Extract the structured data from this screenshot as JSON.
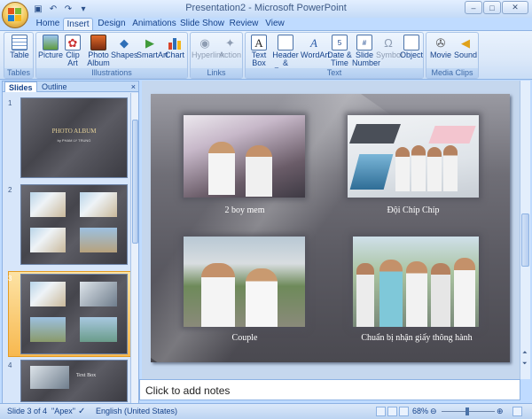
{
  "window": {
    "title": "Presentation2 - Microsoft PowerPoint",
    "buttons": [
      "–",
      "□",
      "✕"
    ]
  },
  "qat": {
    "icons": [
      "save-icon",
      "undo-icon",
      "redo-icon"
    ]
  },
  "tabs": [
    "Home",
    "Insert",
    "Design",
    "Animations",
    "Slide Show",
    "Review",
    "View"
  ],
  "active_tab": "Insert",
  "ribbon": {
    "groups": [
      {
        "label": "Tables",
        "buttons": [
          {
            "label": "Table"
          }
        ]
      },
      {
        "label": "Illustrations",
        "buttons": [
          {
            "label": "Picture"
          },
          {
            "label": "Clip Art"
          },
          {
            "label": "Photo Album"
          },
          {
            "label": "Shapes"
          },
          {
            "label": "SmartArt"
          },
          {
            "label": "Chart"
          }
        ]
      },
      {
        "label": "Links",
        "buttons": [
          {
            "label": "Hyperlink"
          },
          {
            "label": "Action"
          }
        ]
      },
      {
        "label": "Text",
        "buttons": [
          {
            "label": "Text Box"
          },
          {
            "label": "Header & Footer"
          },
          {
            "label": "WordArt"
          },
          {
            "label": "Date & Time"
          },
          {
            "label": "Slide Number"
          },
          {
            "label": "Symbol"
          },
          {
            "label": "Object"
          }
        ]
      },
      {
        "label": "Media Clips",
        "buttons": [
          {
            "label": "Movie"
          },
          {
            "label": "Sound"
          }
        ]
      }
    ]
  },
  "left_pane": {
    "tabs": [
      "Slides",
      "Outline"
    ],
    "close": "×",
    "slides": [
      {
        "num": "1",
        "title": "PHOTO ALBUM",
        "subtitle": "by PHAM LY TRUNG"
      },
      {
        "num": "2"
      },
      {
        "num": "3"
      },
      {
        "num": "4",
        "text": "Text Box"
      }
    ]
  },
  "slide": {
    "captions": [
      "2 boy mem",
      "Đội Chíp Chíp",
      "Couple",
      "Chuẩn bị nhận giấy thông hành"
    ]
  },
  "notes": {
    "placeholder": "Click to add notes"
  },
  "status": {
    "slide": "Slide 3 of 4",
    "theme": "\"Apex\"",
    "language": "English (United States)",
    "zoom": "68%"
  }
}
